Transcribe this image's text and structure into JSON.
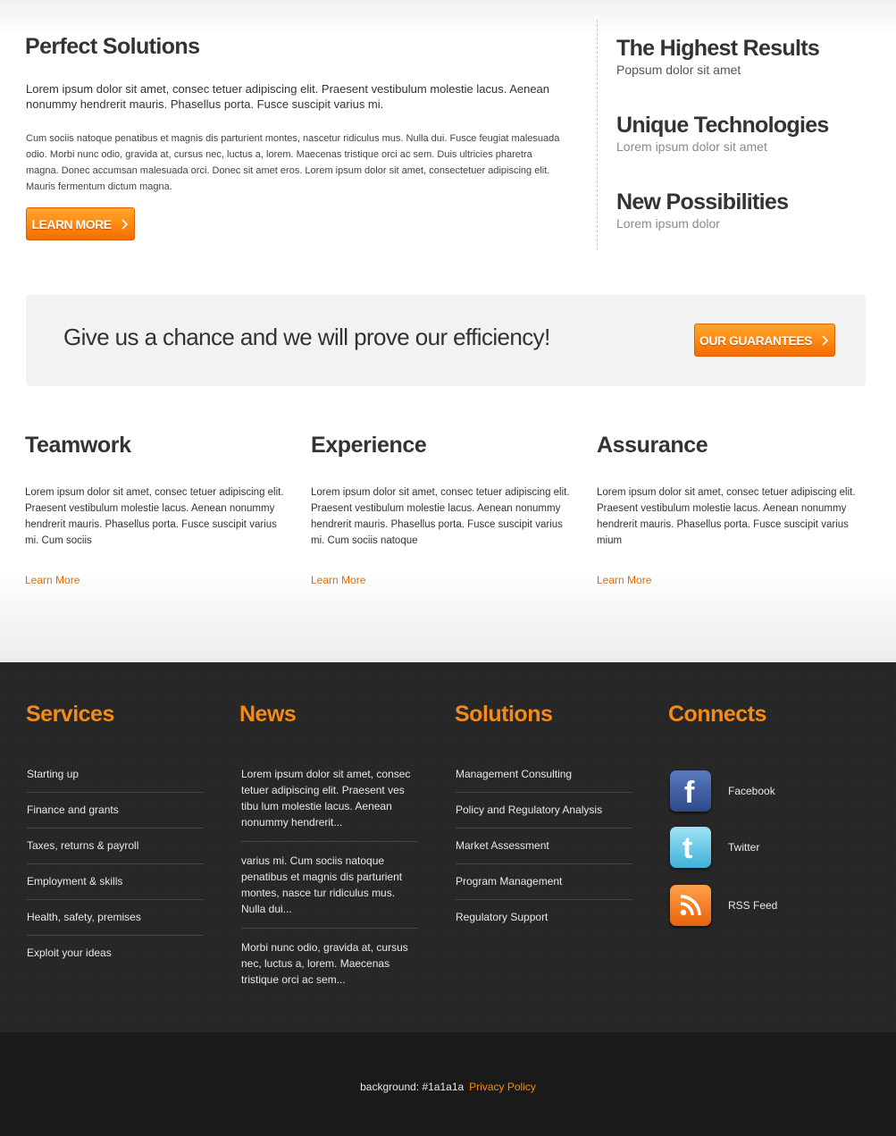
{
  "intro": {
    "title": "Perfect Solutions",
    "lead": "Lorem ipsum dolor sit amet, consec tetuer adipiscing elit. Praesent vestibulum molestie lacus. Aenean nonummy hendrerit mauris. Phasellus porta. Fusce suscipit varius mi.",
    "body": "Cum sociis natoque penatibus et magnis dis parturient montes, nascetur ridiculus mus. Nulla dui. Fusce feugiat malesuada odio. Morbi nunc odio, gravida at, cursus nec, luctus a, lorem. Maecenas tristique orci ac sem. Duis ultricies pharetra magna. Donec accumsan malesuada orci. Donec sit amet eros. Lorem ipsum dolor sit amet, consectetuer adipiscing elit. Mauris fermentum dictum magna.",
    "button_label": "LEARN MORE"
  },
  "features": [
    {
      "title": "The Highest Results",
      "subtitle": "Popsum dolor sit amet"
    },
    {
      "title": "Unique Technologies",
      "subtitle": "Lorem ipsum dolor sit amet"
    },
    {
      "title": "New Possibilities",
      "subtitle": "Lorem ipsum dolor"
    }
  ],
  "banner": {
    "text": "Give us a chance and we will prove our efficiency!",
    "button_label": "OUR GUARANTEES"
  },
  "columns": [
    {
      "title": "Teamwork",
      "text": "Lorem ipsum dolor sit amet, consec tetuer adipiscing elit. Praesent vestibulum molestie lacus. Aenean nonummy hendrerit mauris. Phasellus porta. Fusce suscipit varius mi. Cum sociis",
      "link": "Learn More"
    },
    {
      "title": "Experience",
      "text": "Lorem ipsum dolor sit amet, consec tetuer adipiscing elit. Praesent vestibulum molestie lacus. Aenean nonummy hendrerit mauris. Phasellus porta. Fusce suscipit varius mi. Cum sociis natoque",
      "link": "Learn More"
    },
    {
      "title": "Assurance",
      "text": "Lorem ipsum dolor sit amet, consec tetuer adipiscing elit. Praesent vestibulum molestie lacus. Aenean nonummy hendrerit mauris. Phasellus porta. Fusce suscipit varius mium",
      "link": "Learn More"
    }
  ],
  "footer": {
    "services": {
      "title": "Services",
      "items": [
        "Starting up",
        "Finance and grants",
        "Taxes, returns & payroll",
        "Employment & skills",
        "Health, safety, premises",
        "Exploit your ideas"
      ]
    },
    "news": {
      "title": "News",
      "items": [
        "Lorem ipsum dolor sit amet, consec tetuer adipiscing elit. Praesent ves tibu lum molestie lacus. Aenean nonummy hendrerit...",
        "varius mi. Cum sociis natoque penatibus et magnis dis parturient montes, nasce tur ridiculus mus. Nulla dui...",
        "Morbi nunc odio, gravida at, cursus nec, luctus a, lorem. Maecenas tristique orci ac sem..."
      ]
    },
    "solutions": {
      "title": "Solutions",
      "items": [
        "Management Consulting",
        "Policy and Regulatory Analysis",
        "Market Assessment",
        "Program Management",
        "Regulatory Support"
      ]
    },
    "connects": {
      "title": "Connects",
      "items": [
        {
          "label": "Facebook",
          "icon": "facebook-icon",
          "color": "#3b5998"
        },
        {
          "label": "Twitter",
          "icon": "twitter-icon",
          "color": "#5ec4e8"
        },
        {
          "label": "RSS Feed",
          "icon": "rss-icon",
          "color": "#f37a1f"
        }
      ]
    }
  },
  "bottom": {
    "text": "background: #1a1a1a",
    "privacy_link": "Privacy Policy"
  },
  "colors": {
    "accent": "#f58a14",
    "footer_bg": "#262626",
    "bottom_bg": "#1a1a1a"
  }
}
